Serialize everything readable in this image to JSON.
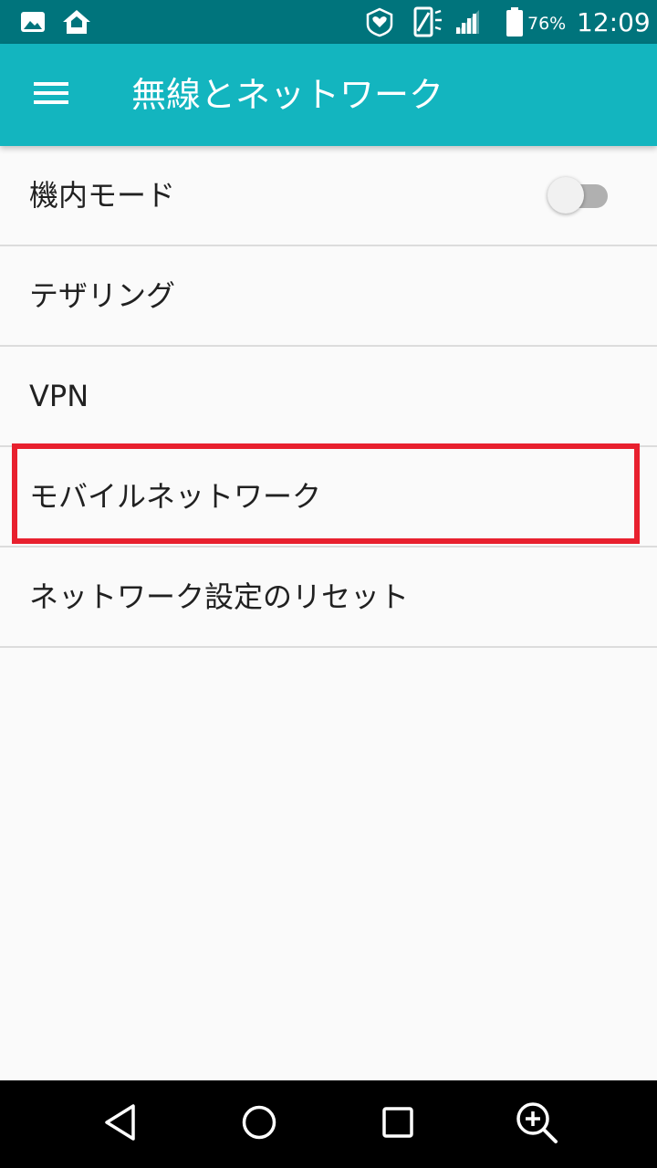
{
  "status_bar": {
    "icons": [
      "image-icon",
      "home-icon",
      "heart-shield-icon",
      "vibrate-icon",
      "signal-icon",
      "battery-icon"
    ],
    "battery_percent": "76%",
    "time": "12:09"
  },
  "app_bar": {
    "title": "無線とネットワーク",
    "menu_icon": "hamburger-menu-icon"
  },
  "settings": {
    "items": [
      {
        "label": "機内モード",
        "toggle": false
      },
      {
        "label": "テザリング"
      },
      {
        "label": "VPN"
      },
      {
        "label": "モバイルネットワーク",
        "highlighted": true
      },
      {
        "label": "ネットワーク設定のリセット"
      }
    ]
  },
  "colors": {
    "status_bar": "#00747c",
    "app_bar": "#13b5bf",
    "highlight": "#e8202e",
    "background": "#fafafa"
  },
  "nav_bar": {
    "icons": [
      "back-icon",
      "home-circle-icon",
      "recents-icon",
      "zoom-icon"
    ]
  }
}
